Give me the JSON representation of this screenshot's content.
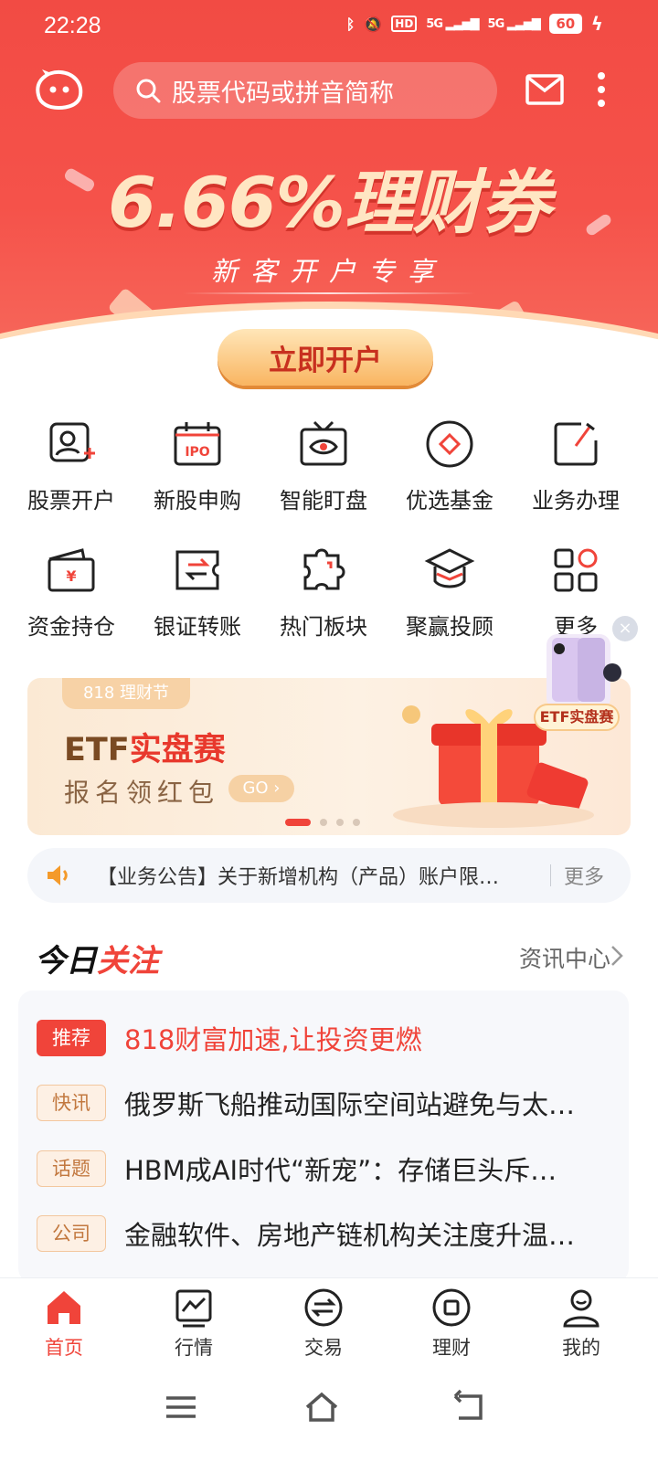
{
  "status_bar": {
    "time": "22:28",
    "hd": "HD",
    "signal1": "5G",
    "signal2": "5G",
    "battery": "60"
  },
  "header": {
    "search_placeholder": "股票代码或拼音简称"
  },
  "hero": {
    "title": "6.66%理财券",
    "subtitle": "新客开户专享",
    "cta_label": "立即开户"
  },
  "grid": [
    {
      "label": "股票开户",
      "icon": "user-add-icon"
    },
    {
      "label": "新股申购",
      "icon": "ipo-calendar-icon"
    },
    {
      "label": "智能盯盘",
      "icon": "tv-eye-icon"
    },
    {
      "label": "优选基金",
      "icon": "diamond-circle-icon"
    },
    {
      "label": "业务办理",
      "icon": "edit-icon"
    },
    {
      "label": "资金持仓",
      "icon": "wallet-icon"
    },
    {
      "label": "银证转账",
      "icon": "transfer-icon"
    },
    {
      "label": "热门板块",
      "icon": "puzzle-icon"
    },
    {
      "label": "聚赢投顾",
      "icon": "graduation-cap-icon"
    },
    {
      "label": "更多",
      "icon": "grid-more-icon"
    }
  ],
  "banner": {
    "tag": "818 理财节",
    "title_prefix": "ETF",
    "title_highlight": "实盘赛",
    "subtitle": "报名领红包",
    "go_label": "GO ›",
    "dots": 4,
    "active_dot": 0
  },
  "float_ad": {
    "label": "ETF实盘赛",
    "close": "×"
  },
  "notice": {
    "text": "【业务公告】关于新增机构（产品）账户限…",
    "more": "更多"
  },
  "today": {
    "title_prefix": "今日",
    "title_highlight": "关注",
    "news_center": "资讯中心"
  },
  "news": [
    {
      "tag": "推荐",
      "text": "818财富加速,让投资更燃",
      "hot": true
    },
    {
      "tag": "快讯",
      "text": "俄罗斯飞船推动国际空间站避免与太…",
      "hot": false
    },
    {
      "tag": "话题",
      "text": "HBM成AI时代“新宠”：存储巨头斥…",
      "hot": false
    },
    {
      "tag": "公司",
      "text": "金融软件、房地产链机构关注度升温…",
      "hot": false
    }
  ],
  "tabs": [
    {
      "label": "首页",
      "icon": "home-icon",
      "active": true
    },
    {
      "label": "行情",
      "icon": "chart-icon",
      "active": false
    },
    {
      "label": "交易",
      "icon": "exchange-icon",
      "active": false
    },
    {
      "label": "理财",
      "icon": "finance-icon",
      "active": false
    },
    {
      "label": "我的",
      "icon": "profile-icon",
      "active": false
    }
  ],
  "colors": {
    "brand_red": "#f0443a",
    "hero_red": "#f24b44",
    "gold": "#f9b561"
  }
}
